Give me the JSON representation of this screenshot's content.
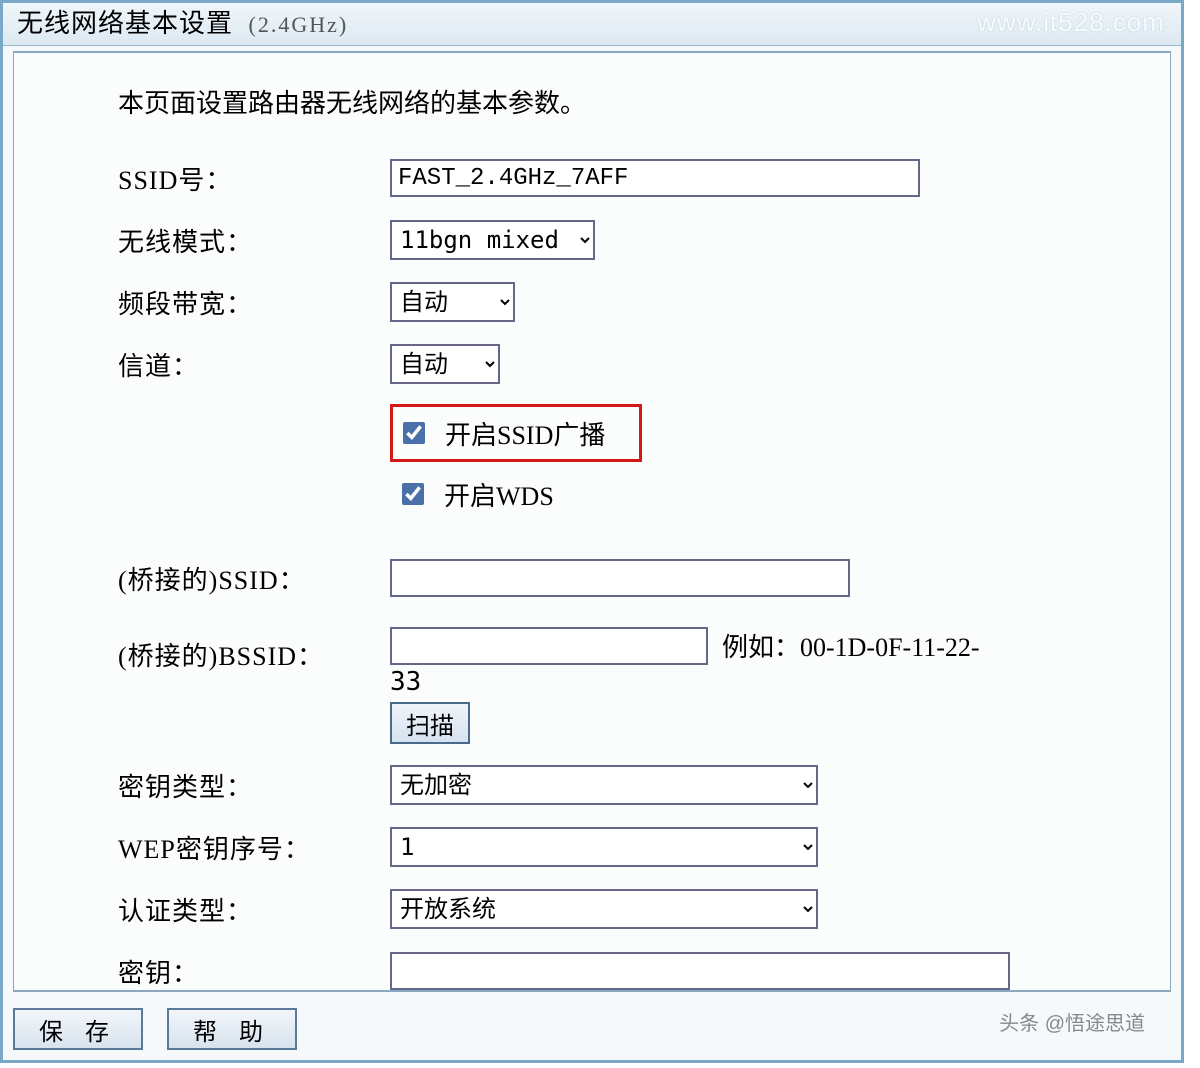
{
  "header": {
    "title": "无线网络基本设置",
    "band": "(2.4GHz)",
    "watermark": "www.it528.com"
  },
  "intro": "本页面设置路由器无线网络的基本参数。",
  "form": {
    "ssid": {
      "label": "SSID号：",
      "value": "FAST_2.4GHz_7AFF"
    },
    "mode": {
      "label": "无线模式：",
      "value": "11bgn mixed"
    },
    "bandwidth": {
      "label": "频段带宽：",
      "value": "自动"
    },
    "channel": {
      "label": "信道：",
      "value": "自动"
    },
    "ssid_broadcast": {
      "label": "开启SSID广播",
      "checked": true
    },
    "wds": {
      "label": "开启WDS",
      "checked": true
    },
    "bridge_ssid": {
      "label": "(桥接的)SSID：",
      "value": ""
    },
    "bridge_bssid": {
      "label": "(桥接的)BSSID：",
      "value": "",
      "example_prefix": "例如：00-1D-0F-11-22-",
      "example_wrap": "33"
    },
    "scan": "扫描",
    "key_type": {
      "label": "密钥类型：",
      "value": "无加密"
    },
    "wep_index": {
      "label": "WEP密钥序号：",
      "value": "1"
    },
    "auth_type": {
      "label": "认证类型：",
      "value": "开放系统"
    },
    "key": {
      "label": "密钥：",
      "value": ""
    }
  },
  "buttons": {
    "save": "保 存",
    "help": "帮 助"
  },
  "attribution": "头条 @悟途思道"
}
